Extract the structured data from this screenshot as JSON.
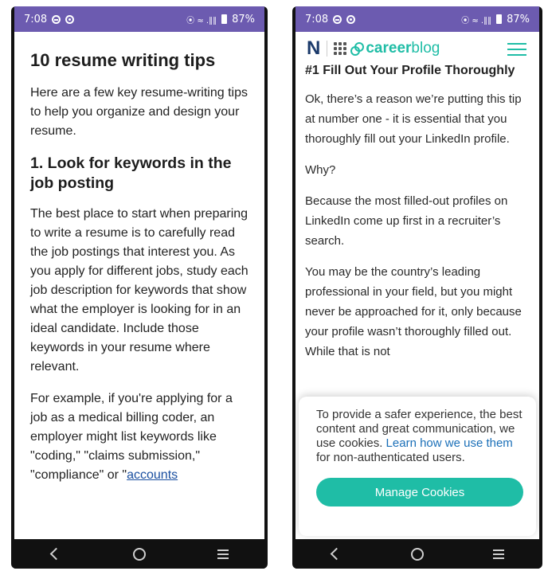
{
  "left": {
    "status": {
      "time": "7:08",
      "battery": "87%",
      "signal": "⦿ ≈ .∥∥"
    },
    "article": {
      "title": "10 resume writing tips",
      "intro": "Here are a few key resume-writing tips to help you organize and design your resume.",
      "section_heading": "1. Look for keywords in the job posting",
      "para1": "The best place to start when preparing to write a resume is to carefully read the job postings that interest you. As you apply for different jobs, study each job description for keywords that show what the employer is looking for in an ideal candidate. Include those keywords in your resume where relevant.",
      "para2_text": "For example, if you're applying for a job as a medical billing coder, an employer might list keywords like \"coding,\" \"claims submission,\" \"compliance\" or \"",
      "para2_link": "accounts"
    }
  },
  "right": {
    "status": {
      "time": "7:08",
      "battery": "87%",
      "signal": "⦿ ≈ .∥∥"
    },
    "header": {
      "logo_letter": "N",
      "brand_bold": "career",
      "brand_rest": "blog"
    },
    "article": {
      "heading": "#1 Fill Out Your Profile Thoroughly",
      "para1": "Ok, there’s a reason we’re putting this tip at number one - it is essential that you thoroughly fill out your LinkedIn profile.",
      "para2": "Why?",
      "para3": "Because the most filled-out profiles on LinkedIn come up first in a recruiter’s search.",
      "para4": "You may be the country’s leading professional in your field, but you might never be approached for it, only because your profile wasn’t thoroughly filled out. While that is not"
    },
    "cookie": {
      "text_before": "To provide a safer experience, the best content and great communication, we use cookies. ",
      "link": "Learn how we use them",
      "text_after": " for non-authenticated users.",
      "button": "Manage Cookies"
    }
  },
  "colors": {
    "statusbar": "#6c5bb0",
    "brand_teal": "#1fbda6",
    "brand_navy": "#1b3a6b",
    "link": "#1a4fa0"
  },
  "icons": [
    "status-sync-icon",
    "status-privacy-icon",
    "battery-icon",
    "back-icon",
    "home-icon",
    "recents-icon",
    "grid-apps-icon",
    "careerblog-logo-icon",
    "hamburger-menu-icon"
  ]
}
